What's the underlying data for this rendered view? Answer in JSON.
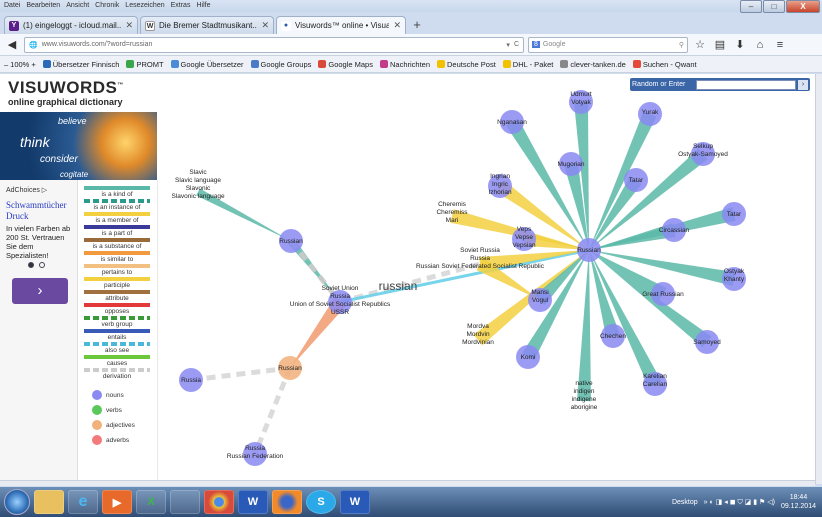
{
  "menubar": {
    "items": [
      "Datei",
      "Bearbeiten",
      "Ansicht",
      "Chronik",
      "Lesezeichen",
      "Extras",
      "Hilfe"
    ]
  },
  "window_controls": {
    "minimize": "–",
    "maximize": "□",
    "close": "X"
  },
  "tabs": [
    {
      "label": "(1) eingeloggt - icloud.mail...",
      "favicon": "Y",
      "color": "#5a1f8a"
    },
    {
      "label": "Die Bremer Stadtmusikant...",
      "favicon": "W",
      "color": "#555"
    },
    {
      "label": "Visuwords™ online • Visual...",
      "favicon": "●",
      "color": "#2a5aa8"
    }
  ],
  "tab_close": "✕",
  "new_tab": "+",
  "nav": {
    "url": "www.visuwords.com/?word=russian",
    "search_placeholder": "Google",
    "back": "◀",
    "reload": "C",
    "star": "☆",
    "download": "⬇",
    "home": "⌂",
    "menu": "≡"
  },
  "bookmarks": [
    {
      "label": "100%",
      "icon_color": "#fff"
    },
    {
      "label": "Übersetzer Finnisch",
      "icon_color": "#2a6ab8"
    },
    {
      "label": "PROMT",
      "icon_color": "#39a64a"
    },
    {
      "label": "Google Übersetzer",
      "icon_color": "#4a8ad8"
    },
    {
      "label": "Google Groups",
      "icon_color": "#4a7ac8"
    },
    {
      "label": "Google Maps",
      "icon_color": "#d84a3a"
    },
    {
      "label": "Nachrichten",
      "icon_color": "#c43a8a"
    },
    {
      "label": "Deutsche Post",
      "icon_color": "#f2c200"
    },
    {
      "label": "DHL - Paket",
      "icon_color": "#f2c200"
    },
    {
      "label": "clever-tanken.de",
      "icon_color": "#888"
    },
    {
      "label": "Suchen - Qwant",
      "icon_color": "#e24a3a"
    }
  ],
  "site": {
    "logo": "VISUWORDS",
    "logo_tm": "™",
    "tagline": "online graphical dictionary",
    "hero_words": [
      "believe",
      "think",
      "consider",
      "cogitate"
    ],
    "random_label": "Random or Enter",
    "go": "›"
  },
  "ad": {
    "choices": "AdChoices ▷",
    "title": "Schwammtücher Druck",
    "text": "In vielen Farben ab 200 St. Vertrauen Sie dem Spezialisten!",
    "button": "›"
  },
  "legend": {
    "relations": [
      {
        "label": "is a kind of",
        "color": "#5ab8a8",
        "style": "solid"
      },
      {
        "label": "is an instance of",
        "color": "#2a9a8a",
        "style": "dashed"
      },
      {
        "label": "is a member of",
        "color": "#f2d040",
        "style": "solid"
      },
      {
        "label": "is a part of",
        "color": "#3a3a9a",
        "style": "solid"
      },
      {
        "label": "is a substance of",
        "color": "#9a6a3a",
        "style": "solid"
      },
      {
        "label": "is similar to",
        "color": "#f29a40",
        "style": "solid"
      },
      {
        "label": "pertains to",
        "color": "#f2c080",
        "style": "solid"
      },
      {
        "label": "participle",
        "color": "#f2d040",
        "style": "solid"
      },
      {
        "label": "attribute",
        "color": "#a07040",
        "style": "solid"
      },
      {
        "label": "opposes",
        "color": "#e23a3a",
        "style": "solid"
      },
      {
        "label": "verb group",
        "color": "#3a9a3a",
        "style": "dashed"
      },
      {
        "label": "entails",
        "color": "#3a5ab8",
        "style": "solid"
      },
      {
        "label": "also see",
        "color": "#4ab8d8",
        "style": "dashed"
      },
      {
        "label": "causes",
        "color": "#6ac83a",
        "style": "solid"
      },
      {
        "label": "derivation",
        "color": "#cccccc",
        "style": "dashed"
      }
    ],
    "types": [
      {
        "label": "nouns",
        "color": "#8a8af2"
      },
      {
        "label": "verbs",
        "color": "#5ac85a"
      },
      {
        "label": "adjectives",
        "color": "#f2b07a"
      },
      {
        "label": "adverbs",
        "color": "#f27a7a"
      }
    ]
  },
  "graph": {
    "center_word": "russian",
    "nodes": {
      "russian_main": {
        "labels": [
          "Russian"
        ]
      },
      "slavic": {
        "labels": [
          "Slavic",
          "Slavic language",
          "Slavonic",
          "Slavonic language"
        ]
      },
      "soviet_union": {
        "labels": [
          "Soviet Union",
          "Russia",
          "Union of Soviet Socialist Republics",
          "USSR"
        ]
      },
      "soviet_russia": {
        "labels": [
          "Soviet Russia",
          "Russia",
          "Russian Soviet Federated Socialist Republic"
        ]
      },
      "adj_russian": {
        "labels": [
          "Russian"
        ]
      },
      "russia_left": {
        "labels": [
          "Russia"
        ]
      },
      "russia_fed": {
        "labels": [
          "Russia",
          "Russian Federation"
        ]
      },
      "hub": {
        "labels": [
          "Russian"
        ]
      },
      "udmurt": {
        "labels": [
          "Udmurt",
          "Votyak"
        ]
      },
      "yurak": {
        "labels": [
          "Yurak"
        ]
      },
      "nganasan": {
        "labels": [
          "Nganasan"
        ]
      },
      "mugorian": {
        "labels": [
          "Mugorian"
        ]
      },
      "uigur": {
        "labels": [
          "Ingrian",
          "Ingric",
          "Izhorian"
        ]
      },
      "cheremis": {
        "labels": [
          "Cheremis",
          "Cheremiss",
          "Mari"
        ]
      },
      "tatar": {
        "labels": [
          "Tatar"
        ]
      },
      "selkup": {
        "labels": [
          "Selkup",
          "Ostyak-Samoyed"
        ]
      },
      "circassian": {
        "labels": [
          "Circassian"
        ]
      },
      "veps": {
        "labels": [
          "Veps",
          "Vepse",
          "Vepsian"
        ]
      },
      "tatar2": {
        "labels": [
          "Tatar"
        ]
      },
      "ostyak": {
        "labels": [
          "Ostyak",
          "Khanty"
        ]
      },
      "great_russian": {
        "labels": [
          "Great Russian"
        ]
      },
      "samoyed": {
        "labels": [
          "Samoyed"
        ]
      },
      "mordva": {
        "labels": [
          "Mordva",
          "Mordvin",
          "Mordvinian"
        ]
      },
      "chechen": {
        "labels": [
          "Chechen"
        ]
      },
      "karelian": {
        "labels": [
          "Karelian",
          "Carelian"
        ]
      },
      "mansi": {
        "labels": [
          "Mansi",
          "Vogul"
        ]
      },
      "komi": {
        "labels": [
          "Komi"
        ]
      },
      "native": {
        "labels": [
          "native",
          "indigen",
          "indigene",
          "aborigine"
        ]
      }
    }
  },
  "taskbar": {
    "apps": [
      "",
      "e",
      "▶",
      "X",
      "",
      "",
      "W",
      "",
      "S",
      "W"
    ],
    "desktop": "Desktop",
    "time": "18:44",
    "date": "09.12.2014"
  }
}
